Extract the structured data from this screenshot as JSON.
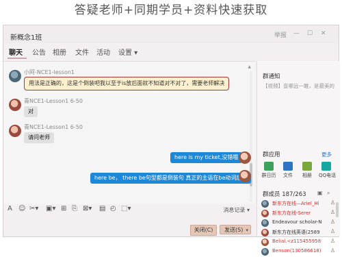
{
  "banner": {
    "text": "答疑老师+同期学员+资料快速获取"
  },
  "window": {
    "title": "新概念1班",
    "controls": {
      "report": "举报",
      "minimize": "—",
      "maximize": "☐",
      "close": "✕"
    }
  },
  "tabs": [
    "聊天",
    "公告",
    "相册",
    "文件",
    "活动",
    "设置 ▾"
  ],
  "messages": [
    {
      "sender": "小阿-NCE1-lesson1",
      "text": "用法是正确的，这是个倒装吧我以至于is放后面就不知道对不对了，需要老师解决"
    },
    {
      "sender": "青NCE1-Lesson1    6-50",
      "text": "对"
    },
    {
      "sender": "青NCE1-Lesson1    6-50",
      "text": "请问老师"
    },
    {
      "text": "here is my ticket,没错哦"
    },
    {
      "text": "here be， there be句型都是倒装句 真正的主语在be动词后边"
    }
  ],
  "toolbar": {
    "icons": [
      "A",
      "☺",
      "✂▾",
      "▣▾",
      "⊞",
      "⎘",
      "⊠▾",
      "▤",
      "◴",
      "⬚▾"
    ],
    "history_label": "消息记录 ▾",
    "close_label": "关闭(C)",
    "send_label": "发送(S)",
    "send_caret": "▾"
  },
  "sidebar": {
    "notice_title": "群通知",
    "notice_text": "【视频】壹哪远一雎，是最美的",
    "apps_title": "群应用",
    "more_label": "更多",
    "apps": [
      {
        "label": "群日历",
        "color": "#3ca15a"
      },
      {
        "label": "文件",
        "color": "#2f73c4"
      },
      {
        "label": "相册",
        "color": "#7aa83c"
      },
      {
        "label": "QQ电话",
        "color": "#15a6a0"
      }
    ],
    "members_title": "群成员 187/263",
    "member_tools": [
      "▣",
      "⌕"
    ],
    "members": [
      {
        "name": "新东方在线—Ariel_Hi",
        "color": "#d42f2f",
        "icon": "♙"
      },
      {
        "name": "新东方在线-Serer",
        "color": "#d42f2f",
        "icon": "♙"
      },
      {
        "name": "Endeavour scholar-NCE",
        "color": "#333333",
        "icon": "♙"
      },
      {
        "name": "新东方在线英语(2589",
        "color": "#333333",
        "icon": "♙"
      },
      {
        "name": "Belial.<z1154559589@",
        "color": "#d42f2f",
        "icon": "♙"
      },
      {
        "name": "Benson(130586618)",
        "color": "#d42f2f",
        "icon": "♙"
      }
    ]
  }
}
